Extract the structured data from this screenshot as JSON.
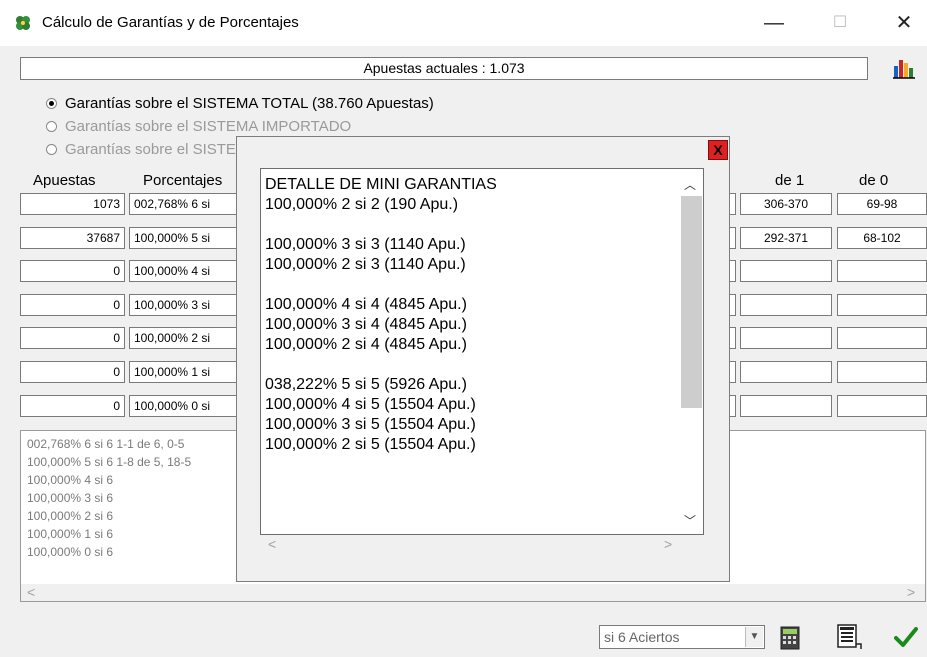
{
  "window": {
    "title": "Cálculo de Garantías y de Porcentajes",
    "minimize": "—",
    "maximize": "☐",
    "close": "✕"
  },
  "apuestas_actuales": "Apuestas actuales : 1.073",
  "radios": [
    {
      "label": "Garantías sobre el SISTEMA TOTAL (38.760 Apuestas)",
      "checked": true,
      "enabled": true
    },
    {
      "label": "Garantías sobre el SISTEMA IMPORTADO",
      "checked": false,
      "enabled": false
    },
    {
      "label": "Garantías sobre el SISTEMA",
      "checked": false,
      "enabled": false
    }
  ],
  "headers": {
    "apuestas": "Apuestas",
    "porcentajes": "Porcentajes",
    "de1": "de 1",
    "de0": "de 0"
  },
  "rows": [
    {
      "apuestas": "1073",
      "porcentaje": "002,768% 6 si",
      "de1": "306-370",
      "de0": "69-98"
    },
    {
      "apuestas": "37687",
      "porcentaje": "100,000% 5 si",
      "de1": "292-371",
      "de0": "68-102"
    },
    {
      "apuestas": "0",
      "porcentaje": "100,000% 4 si",
      "de1": "",
      "de0": ""
    },
    {
      "apuestas": "0",
      "porcentaje": "100,000% 3 si",
      "de1": "",
      "de0": ""
    },
    {
      "apuestas": "0",
      "porcentaje": "100,000% 2 si",
      "de1": "",
      "de0": ""
    },
    {
      "apuestas": "0",
      "porcentaje": "100,000% 1 si",
      "de1": "",
      "de0": ""
    },
    {
      "apuestas": "0",
      "porcentaje": "100,000% 0 si",
      "de1": "",
      "de0": ""
    }
  ],
  "log_lines": [
    "002,768% 6 si 6  1-1 de 6, 0-5",
    "100,000% 5 si 6  1-8 de 5, 18-5",
    "100,000% 4 si 6",
    "100,000% 3 si 6",
    "100,000% 2 si 6",
    "100,000% 1 si 6",
    "100,000% 0 si 6"
  ],
  "modal": {
    "close": "X",
    "lines": [
      "DETALLE DE MINI GARANTIAS",
      "100,000% 2 si 2 (190 Apu.)",
      "",
      "100,000% 3 si 3 (1140 Apu.)",
      "100,000% 2 si 3 (1140 Apu.)",
      "",
      "100,000% 4 si 4 (4845 Apu.)",
      "100,000% 3 si 4 (4845 Apu.)",
      "100,000% 2 si 4 (4845 Apu.)",
      "",
      "038,222% 5 si 5 (5926 Apu.)",
      "100,000% 4 si 5 (15504 Apu.)",
      "100,000% 3 si 5 (15504 Apu.)",
      "100,000% 2 si 5 (15504 Apu.)"
    ]
  },
  "aciertos_select": "si 6 Aciertos",
  "colors": {
    "close_red": "#e02020",
    "check_green": "#1a8a1a"
  }
}
